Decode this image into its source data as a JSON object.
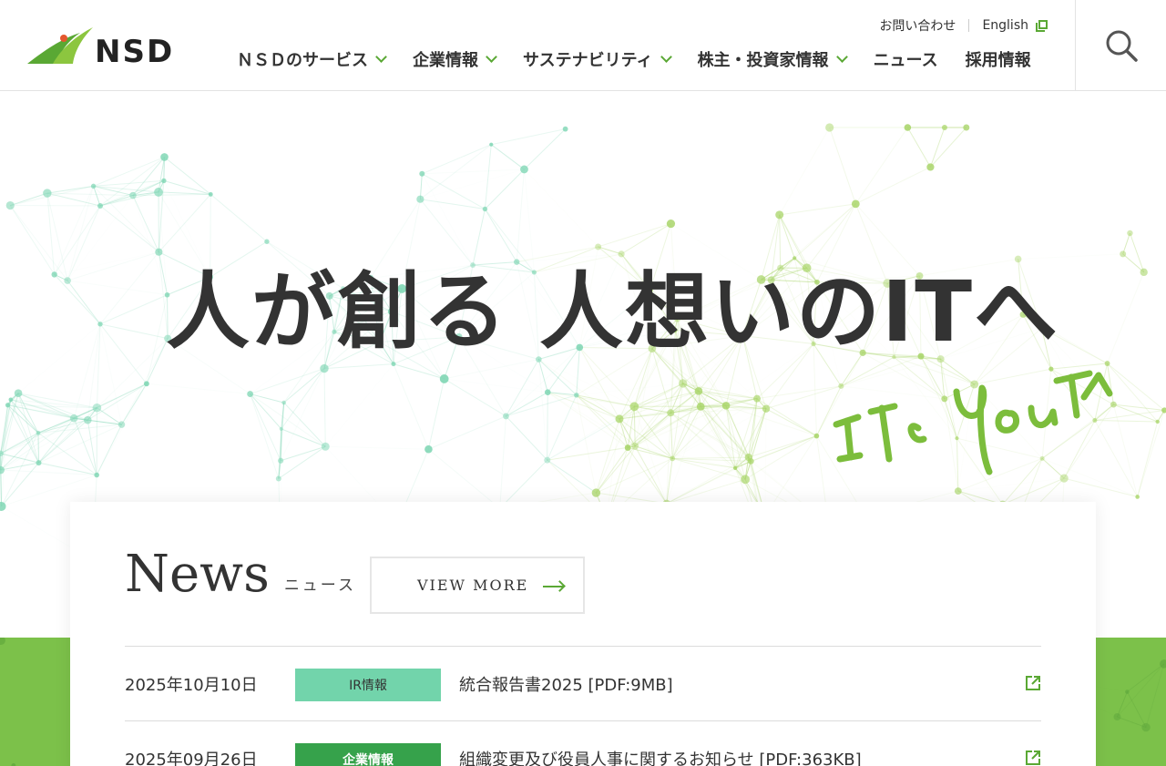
{
  "header": {
    "logo_text": "NSD",
    "util": {
      "contact": "お問い合わせ",
      "english": "English"
    },
    "nav": [
      {
        "label": "ＮＳＤのサービス",
        "has_dropdown": true
      },
      {
        "label": "企業情報",
        "has_dropdown": true
      },
      {
        "label": "サステナビリティ",
        "has_dropdown": true
      },
      {
        "label": "株主・投資家情報",
        "has_dropdown": true
      },
      {
        "label": "ニュース",
        "has_dropdown": false
      },
      {
        "label": "採用情報",
        "has_dropdown": false
      }
    ],
    "search_icon": "search-icon"
  },
  "hero": {
    "title": "人が創る 人想いのITへ",
    "handwritten": "IT to You T へ"
  },
  "news": {
    "title": "News",
    "subtitle": "ニュース",
    "view_more": "VIEW MORE",
    "items": [
      {
        "date": "2025年10月10日",
        "tag": "IR情報",
        "tag_color": "#72d4ab",
        "title": "統合報告書2025 [PDF:9MB]"
      },
      {
        "date": "2025年09月26日",
        "tag": "企業情報",
        "tag_color": "#36a24b",
        "title": "組織変更及び役員人事に関するお知らせ [PDF:363KB]"
      }
    ]
  },
  "colors": {
    "accent": "#5aa834",
    "band": "#7cc14a"
  }
}
